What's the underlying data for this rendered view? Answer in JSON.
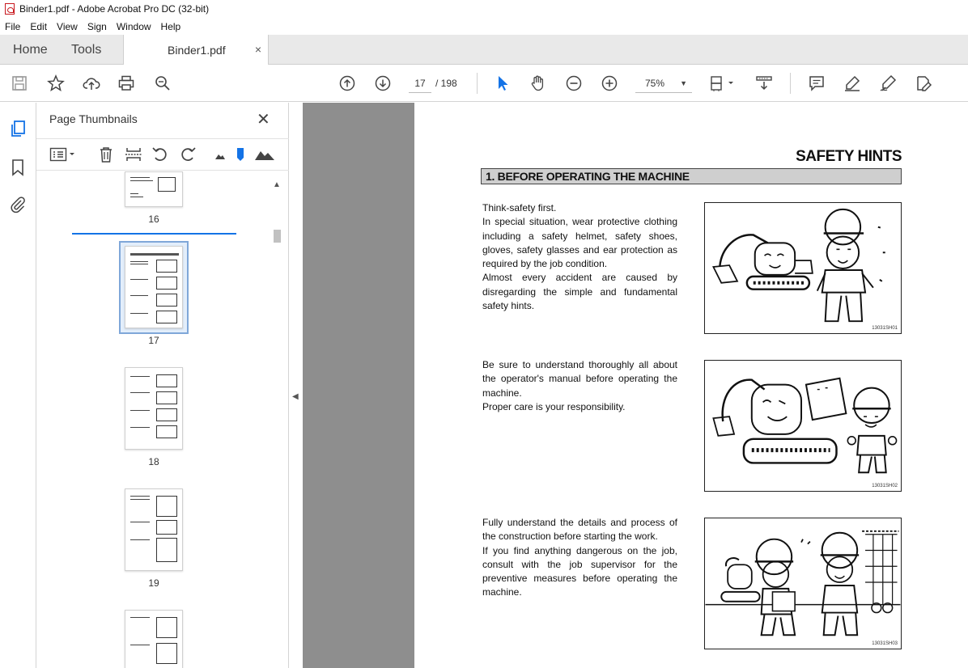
{
  "window": {
    "title": "Binder1.pdf - Adobe Acrobat Pro DC (32-bit)"
  },
  "menu": [
    "File",
    "Edit",
    "View",
    "Sign",
    "Window",
    "Help"
  ],
  "tabs": {
    "home": "Home",
    "tools": "Tools",
    "document": "Binder1.pdf",
    "close_glyph": "×"
  },
  "toolbar": {
    "current_page": "17",
    "total_pages": "/ 198",
    "zoom": "75%"
  },
  "thumbnails": {
    "title": "Page Thumbnails",
    "close_glyph": "✕",
    "pages": [
      "16",
      "17",
      "18",
      "19"
    ]
  },
  "document": {
    "heading": "SAFETY HINTS",
    "section": "1. BEFORE OPERATING THE MACHINE",
    "blocks": [
      {
        "lines": [
          "Think-safety first.",
          "In special situation, wear protective clothing including a safety helmet, safety shoes, gloves, safety glasses and ear protection as required by the job condition.",
          "Almost every accident are caused by disregarding the simple and fundamental safety hints."
        ],
        "figure": "13031SH01"
      },
      {
        "lines": [
          "Be sure to understand thoroughly all about the operator's manual before operating the machine.",
          "Proper care is your responsibility."
        ],
        "figure": "13031SH02"
      },
      {
        "lines": [
          "Fully understand the details and process of the construction before starting the work.",
          "If you find anything dangerous on the job, consult with the job supervisor for the preventive measures before operating the machine."
        ],
        "figure": "13031SH03"
      }
    ]
  }
}
